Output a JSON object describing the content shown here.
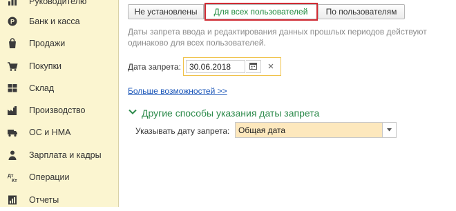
{
  "sidebar": {
    "items": [
      {
        "label": "Руководителю",
        "icon": "chart-icon"
      },
      {
        "label": "Банк и касса",
        "icon": "coin-icon"
      },
      {
        "label": "Продажи",
        "icon": "bag-icon"
      },
      {
        "label": "Покупки",
        "icon": "cart-icon"
      },
      {
        "label": "Склад",
        "icon": "grid-icon"
      },
      {
        "label": "Производство",
        "icon": "factory-icon"
      },
      {
        "label": "ОС и НМА",
        "icon": "truck-icon"
      },
      {
        "label": "Зарплата и кадры",
        "icon": "person-icon"
      },
      {
        "label": "Операции",
        "icon": "operations-icon"
      },
      {
        "label": "Отчеты",
        "icon": "report-icon"
      }
    ]
  },
  "tabs": {
    "not_set": "Не установлены",
    "all_users": "Для всех пользователей",
    "by_user": "По пользователям",
    "selected": "all_users"
  },
  "note": "Даты запрета ввода и редактирования данных прошлых периодов действуют одинаково для всех пользователей.",
  "date_field": {
    "label": "Дата запрета:",
    "value": "30.06.2018"
  },
  "more_link": "Больше возможностей >>",
  "group": {
    "title": "Другие способы указания даты запрета",
    "field_label": "Указывать дату запрета:",
    "field_value": "Общая дата"
  },
  "colors": {
    "sidebar_bg": "#fbf5d0",
    "accent_green": "#2c8a4b",
    "highlight_red": "#d12b34",
    "link_blue": "#1a55b8",
    "field_yellow": "#fde8bd"
  }
}
